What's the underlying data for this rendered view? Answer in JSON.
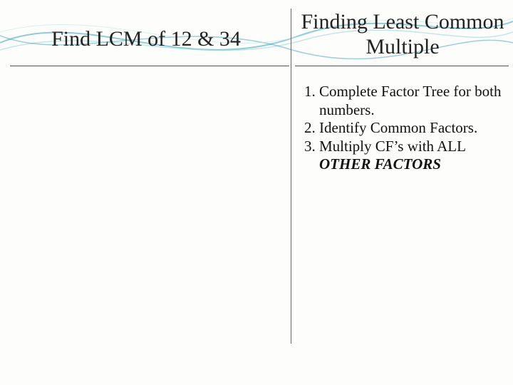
{
  "left": {
    "title": "Find LCM of 12 & 34"
  },
  "right": {
    "title": "Finding Least Common Multiple",
    "steps": [
      "Complete Factor Tree for both numbers.",
      "Identify Common Factors."
    ],
    "step3_prefix": "Multiply CF’s with ALL ",
    "step3_suffix": "OTHER FACTORS"
  }
}
